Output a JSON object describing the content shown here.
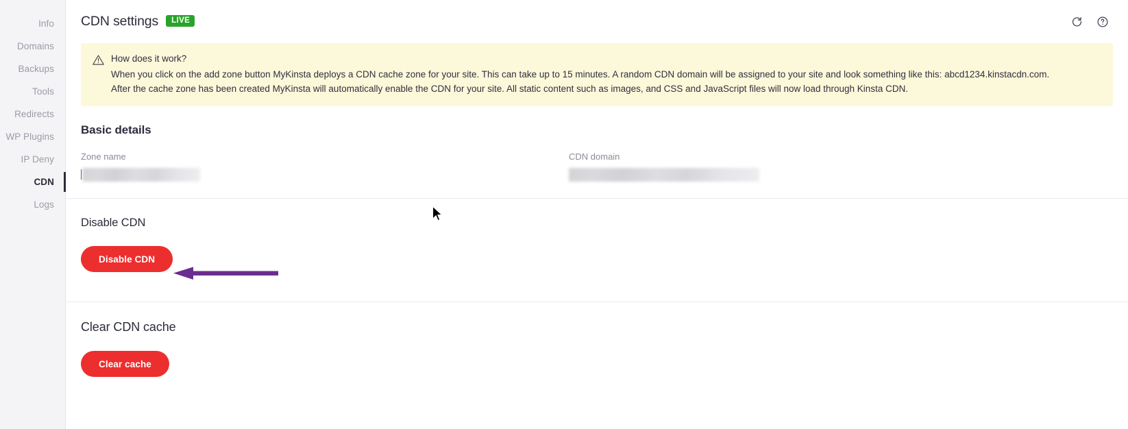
{
  "sidebar": {
    "items": [
      {
        "label": "Info",
        "active": false
      },
      {
        "label": "Domains",
        "active": false
      },
      {
        "label": "Backups",
        "active": false
      },
      {
        "label": "Tools",
        "active": false
      },
      {
        "label": "Redirects",
        "active": false
      },
      {
        "label": "WP Plugins",
        "active": false
      },
      {
        "label": "IP Deny",
        "active": false
      },
      {
        "label": "CDN",
        "active": true
      },
      {
        "label": "Logs",
        "active": false
      }
    ]
  },
  "header": {
    "title": "CDN settings",
    "badge": "LIVE",
    "badge_color": "#29a329",
    "refresh_icon": "refresh-icon",
    "help_icon": "help-circle-icon"
  },
  "callout": {
    "icon": "warning-triangle-icon",
    "title": "How does it work?",
    "line1": "When you click on the add zone button MyKinsta deploys a CDN cache zone for your site. This can take up to 15 minutes. A random CDN domain will be assigned to your site and look something like this: abcd1234.kinstacdn.com.",
    "line2": "After the cache zone has been created MyKinsta will automatically enable the CDN for your site. All static content such as images, and CSS and JavaScript files will now load through Kinsta CDN.",
    "background": "#fcf8da"
  },
  "basic_details": {
    "heading": "Basic details",
    "fields": [
      {
        "label": "Zone name",
        "value": "",
        "redacted": true
      },
      {
        "label": "CDN domain",
        "value": "",
        "redacted": true
      }
    ]
  },
  "disable_section": {
    "heading": "Disable CDN",
    "button_label": "Disable CDN",
    "button_color": "#ed2e2e"
  },
  "clear_section": {
    "heading": "Clear CDN cache",
    "button_label": "Clear cache",
    "button_color": "#ed2e2e"
  },
  "annotation": {
    "arrow_color": "#6b2d8f",
    "points_to": "Disable CDN"
  }
}
